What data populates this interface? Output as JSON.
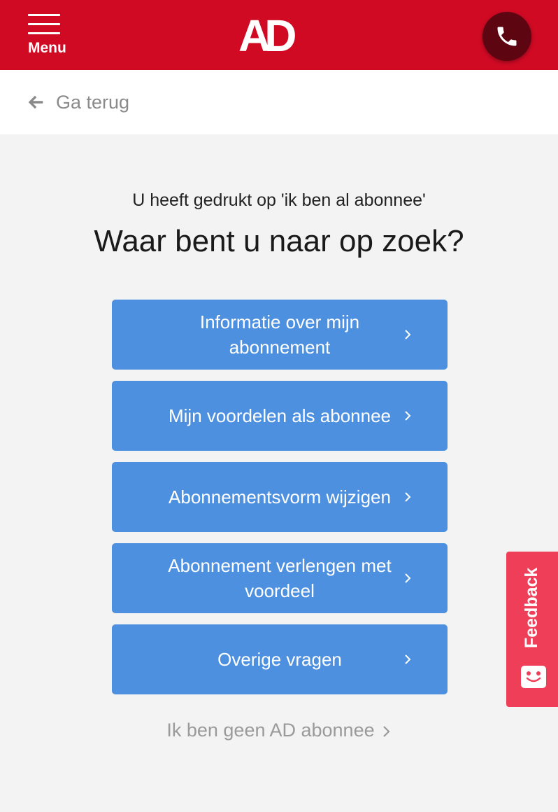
{
  "header": {
    "menu_label": "Menu",
    "logo_text": "AD",
    "menu_icon": "hamburger-icon",
    "phone_icon": "phone-icon",
    "colors": {
      "brand_red": "#d10a24",
      "phone_bg": "#5e0512"
    }
  },
  "back": {
    "label": "Ga terug",
    "icon": "arrow-left-icon"
  },
  "main": {
    "intro": "U heeft gedrukt op 'ik ben al abonnee'",
    "heading": "Waar bent u naar op zoek?",
    "options": [
      {
        "label": "Informatie over mijn abonnement"
      },
      {
        "label": "Mijn voordelen als abonnee"
      },
      {
        "label": "Abonnementsvorm wijzigen"
      },
      {
        "label": "Abonnement verlengen met voordeel"
      },
      {
        "label": "Overige vragen"
      }
    ],
    "not_subscriber_link": "Ik ben geen AD abonnee",
    "colors": {
      "option_bg": "#4d90df"
    }
  },
  "feedback": {
    "label": "Feedback",
    "icon": "smiley-icon",
    "color": "#ef3e57"
  }
}
